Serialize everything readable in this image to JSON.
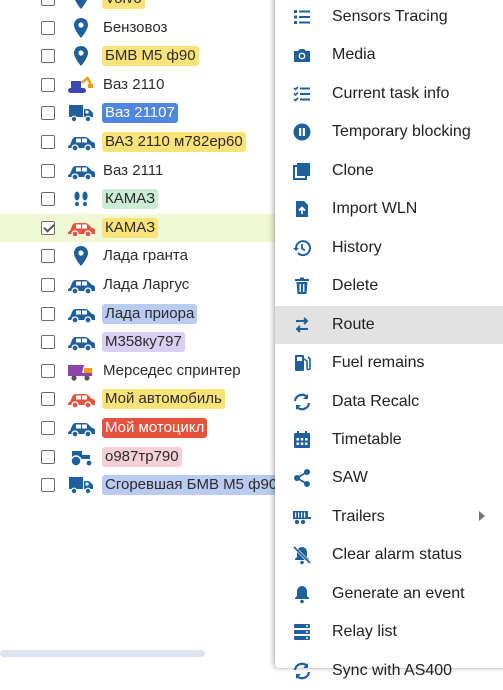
{
  "colors": {
    "accent": "#1f5f9c",
    "selected_row": "#f1f8d4",
    "menu_highlight": "#e2e2e2"
  },
  "objects": [
    {
      "name": "Volvo",
      "icon": "map-pin",
      "tag": "yellow",
      "checked": false
    },
    {
      "name": "Бензовоз",
      "icon": "map-pin",
      "tag": "none",
      "checked": false
    },
    {
      "name": "БМВ M5 ф90",
      "icon": "map-pin",
      "tag": "yellow",
      "checked": false
    },
    {
      "name": "Ваз 2110",
      "icon": "excavator",
      "tag": "none",
      "checked": false
    },
    {
      "name": "Ваз 21107",
      "icon": "truck",
      "tag": "blue",
      "checked": false
    },
    {
      "name": "ВАЗ 2110 м782ер60",
      "icon": "car",
      "tag": "yellow",
      "checked": false
    },
    {
      "name": "Ваз 2111",
      "icon": "car",
      "tag": "none",
      "checked": false
    },
    {
      "name": "КАМАЗ",
      "icon": "footprints",
      "tag": "green",
      "checked": false
    },
    {
      "name": "КАМАЗ",
      "icon": "car-red",
      "tag": "yellow",
      "checked": true
    },
    {
      "name": "Лада гранта",
      "icon": "map-pin",
      "tag": "none",
      "checked": false
    },
    {
      "name": "Лада Ларгус",
      "icon": "car",
      "tag": "none",
      "checked": false
    },
    {
      "name": "Лада приора",
      "icon": "car",
      "tag": "lightblue",
      "checked": false
    },
    {
      "name": "М358ку797",
      "icon": "car",
      "tag": "purple",
      "checked": false
    },
    {
      "name": "Мерседес спринтер",
      "icon": "dump-truck",
      "tag": "none",
      "checked": false
    },
    {
      "name": "Мой автомобиль",
      "icon": "car-red",
      "tag": "yellow",
      "checked": false
    },
    {
      "name": "Мой мотоцикл",
      "icon": "car",
      "tag": "red",
      "checked": false
    },
    {
      "name": "о987тр790",
      "icon": "tractor",
      "tag": "pink",
      "checked": false
    },
    {
      "name": "Сгоревшая БМВ M5 ф90",
      "icon": "truck",
      "tag": "lightblue",
      "checked": false
    }
  ],
  "menu": [
    {
      "label": "Sensors Tracing",
      "icon": "list-icon"
    },
    {
      "label": "Media",
      "icon": "camera-icon"
    },
    {
      "label": "Current task info",
      "icon": "checklist-icon"
    },
    {
      "label": "Temporary blocking",
      "icon": "pause-icon"
    },
    {
      "label": "Clone",
      "icon": "clone-icon"
    },
    {
      "label": "Import WLN",
      "icon": "import-file-icon"
    },
    {
      "label": "History",
      "icon": "history-icon"
    },
    {
      "label": "Delete",
      "icon": "trash-icon"
    },
    {
      "label": "Route",
      "icon": "route-icon",
      "highlighted": true
    },
    {
      "label": "Fuel remains",
      "icon": "fuel-icon"
    },
    {
      "label": "Data Recalc",
      "icon": "recalc-icon"
    },
    {
      "label": "Timetable",
      "icon": "calendar-icon"
    },
    {
      "label": "SAW",
      "icon": "share-icon"
    },
    {
      "label": "Trailers",
      "icon": "trailer-icon",
      "submenu": true
    },
    {
      "label": "Clear alarm status",
      "icon": "alarm-off-icon"
    },
    {
      "label": "Generate an event",
      "icon": "bell-icon"
    },
    {
      "label": "Relay list",
      "icon": "relay-list-icon"
    },
    {
      "label": "Sync with AS400",
      "icon": "sync-icon"
    }
  ]
}
